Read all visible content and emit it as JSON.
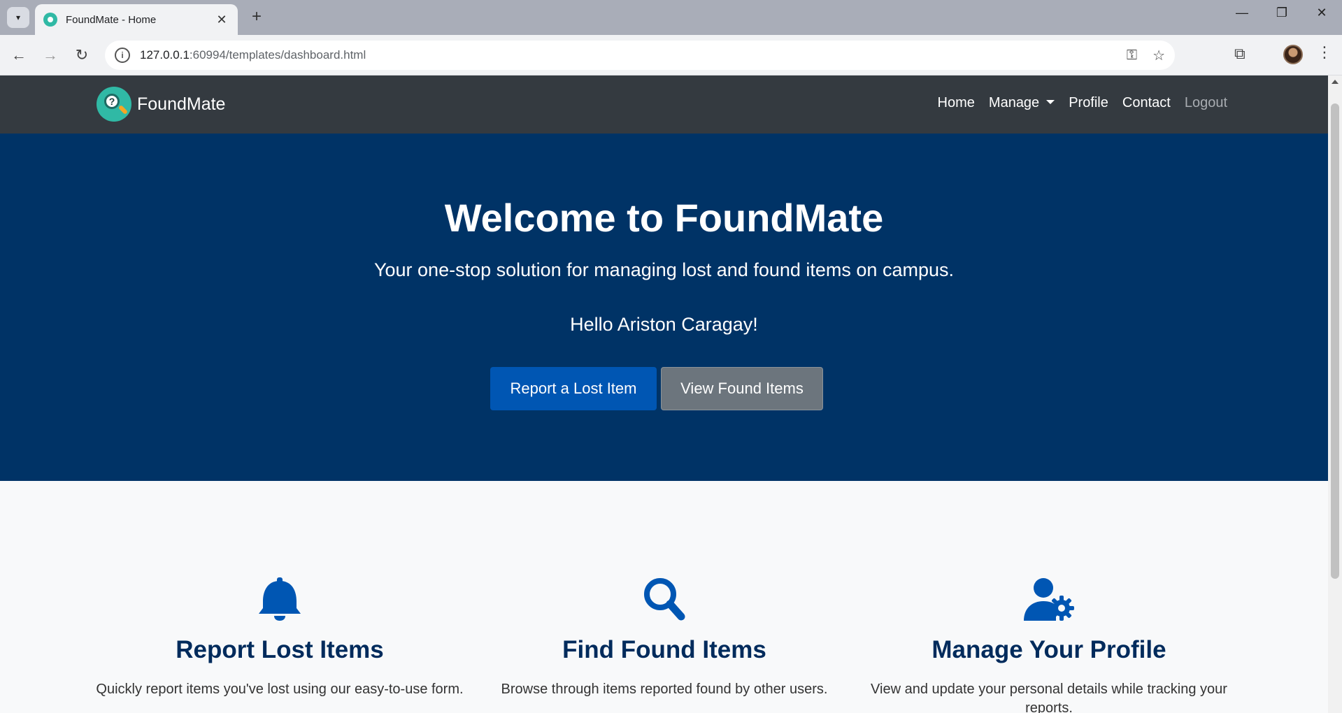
{
  "browser": {
    "tab_title": "FoundMate - Home",
    "url_host": "127.0.0.1",
    "url_rest": ":60994/templates/dashboard.html"
  },
  "navbar": {
    "brand": "FoundMate",
    "links": {
      "home": "Home",
      "manage": "Manage",
      "profile": "Profile",
      "contact": "Contact",
      "logout": "Logout"
    }
  },
  "hero": {
    "title": "Welcome to FoundMate",
    "subtitle": "Your one-stop solution for managing lost and found items on campus.",
    "greeting": "Hello Ariston Caragay!",
    "primary_button": "Report a Lost Item",
    "secondary_button": "View Found Items"
  },
  "features": [
    {
      "icon": "bell-icon",
      "title": "Report Lost Items",
      "text": "Quickly report items you've lost using our easy-to-use form."
    },
    {
      "icon": "search-icon",
      "title": "Find Found Items",
      "text": "Browse through items reported found by other users."
    },
    {
      "icon": "user-gear-icon",
      "title": "Manage Your Profile",
      "text": "View and update your personal details while tracking your reports."
    }
  ],
  "colors": {
    "navbar": "#343a40",
    "hero": "#003366",
    "primary": "#0056b3",
    "secondary": "#6c757d",
    "feature_icon": "#0056b3",
    "feature_title": "#002b5c"
  }
}
